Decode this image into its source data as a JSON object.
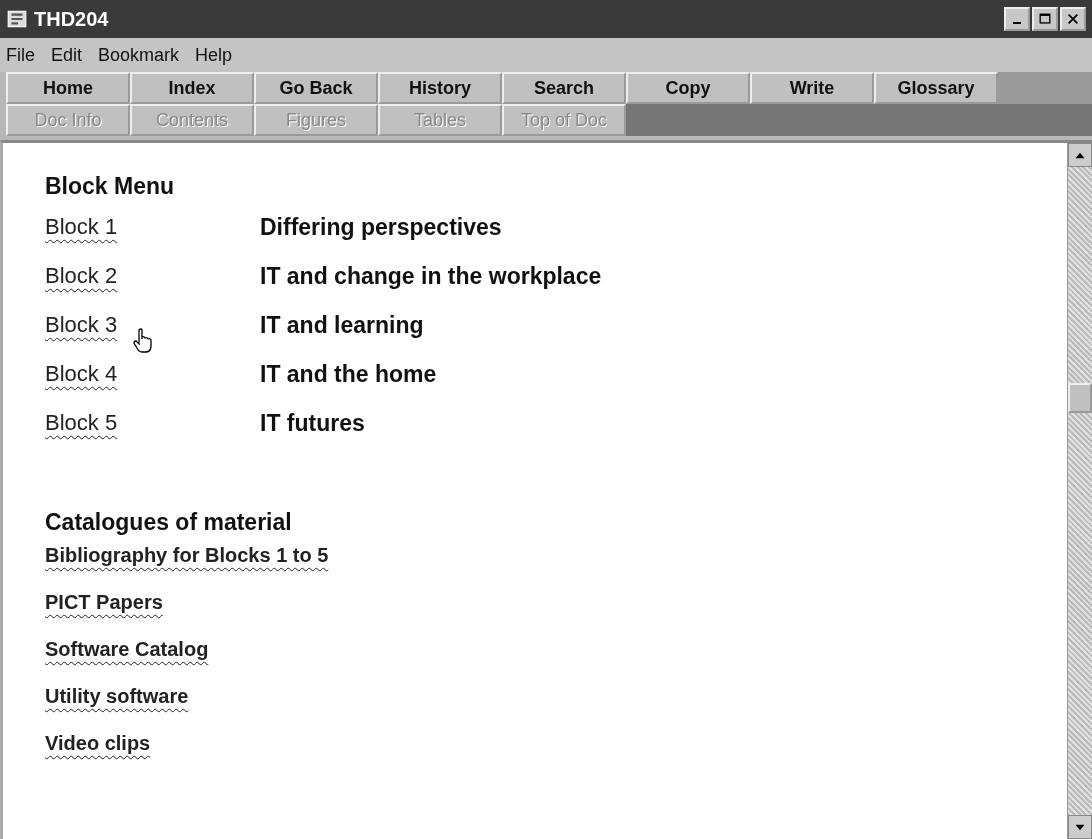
{
  "window": {
    "title": "THD204"
  },
  "menu": [
    "File",
    "Edit",
    "Bookmark",
    "Help"
  ],
  "toolbar": [
    {
      "label": "Home",
      "disabled": false
    },
    {
      "label": "Index",
      "disabled": false
    },
    {
      "label": "Go Back",
      "disabled": false
    },
    {
      "label": "History",
      "disabled": false
    },
    {
      "label": "Search",
      "disabled": false
    },
    {
      "label": "Copy",
      "disabled": false
    },
    {
      "label": "Write",
      "disabled": false
    },
    {
      "label": "Glossary",
      "disabled": false
    }
  ],
  "toolbar_2": [
    {
      "label": "Doc Info",
      "disabled": true
    },
    {
      "label": "Contents",
      "disabled": true
    },
    {
      "label": "Figures",
      "disabled": true
    },
    {
      "label": "Tables",
      "disabled": true
    },
    {
      "label": "Top of Doc",
      "disabled": true
    }
  ],
  "block_menu": {
    "heading": "Block Menu",
    "items": [
      {
        "link": "Block 1",
        "title": "Differing perspectives"
      },
      {
        "link": "Block 2",
        "title": "IT and change in the workplace"
      },
      {
        "link": "Block 3",
        "title": "IT and learning"
      },
      {
        "link": "Block 4",
        "title": "IT and the home"
      },
      {
        "link": "Block 5",
        "title": "IT futures"
      }
    ]
  },
  "catalogues": {
    "heading": "Catalogues of material",
    "links": [
      "Bibliography for Blocks 1 to 5",
      "PICT Papers",
      "Software Catalog",
      "Utility software",
      "Video clips"
    ]
  }
}
